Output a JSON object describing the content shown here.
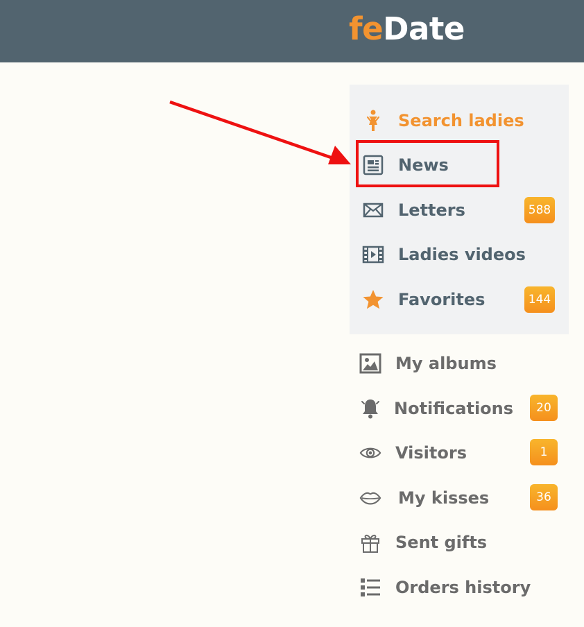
{
  "header": {
    "logo_part1": "fe",
    "logo_part2": "Date"
  },
  "colors": {
    "header": "#52646f",
    "accent": "#f29330",
    "highlight": "#ee1111",
    "badge": "#f5a020"
  },
  "main_menu": [
    {
      "label": "Search ladies",
      "icon": "person-female-icon"
    },
    {
      "label": "News",
      "icon": "newspaper-icon"
    },
    {
      "label": "Letters",
      "icon": "envelope-icon",
      "badge": "588"
    },
    {
      "label": "Ladies videos",
      "icon": "film-icon"
    },
    {
      "label": "Favorites",
      "icon": "star-icon",
      "badge": "144"
    }
  ],
  "user_menu": [
    {
      "label": "My albums",
      "icon": "image-icon"
    },
    {
      "label": "Notifications",
      "icon": "bell-icon",
      "badge": "20"
    },
    {
      "label": "Visitors",
      "icon": "eye-icon",
      "badge": "1"
    },
    {
      "label": "My kisses",
      "icon": "lips-icon",
      "badge": "36"
    },
    {
      "label": "Sent gifts",
      "icon": "gift-icon"
    },
    {
      "label": "Orders history",
      "icon": "list-icon"
    }
  ]
}
